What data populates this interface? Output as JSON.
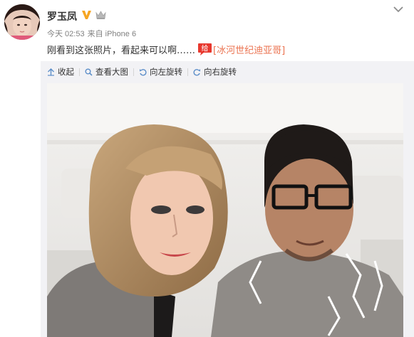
{
  "post": {
    "username": "罗玉凤",
    "meta": {
      "time": "今天 02:53",
      "source": "来自 iPhone 6"
    },
    "text": "刚看到这张照片，看起来可以啊……",
    "gift_label": "给",
    "topic": "[冰河世纪迪亚哥]"
  },
  "toolbar": {
    "collapse": "收起",
    "view_large": "查看大图",
    "rotate_left": "向左旋转",
    "rotate_right": "向右旋转"
  },
  "icons": {
    "verified": "verified-v-badge",
    "member": "member-crown",
    "more": "chevron-down",
    "collapse": "arrow-up",
    "view_large": "magnifier",
    "rotate_left": "rotate-left",
    "rotate_right": "rotate-right"
  },
  "colors": {
    "verified_badge": "#f6a623",
    "link": "#eb7350",
    "gift_badge": "#e8382e",
    "meta_text": "#808080"
  }
}
